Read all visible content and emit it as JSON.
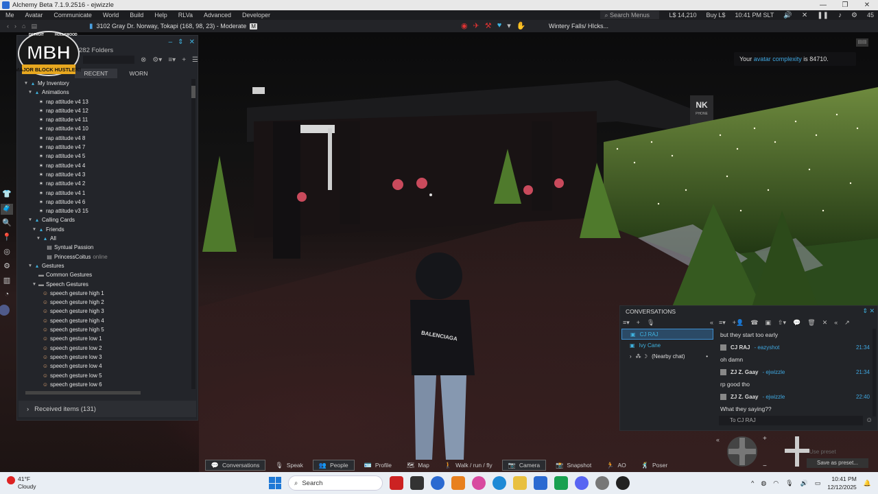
{
  "window": {
    "title": "Alchemy Beta 7.1.9.2516 - ejwizzle",
    "controls": [
      "—",
      "❐",
      "✕"
    ]
  },
  "menubar": {
    "items": [
      "Me",
      "Avatar",
      "Communicate",
      "World",
      "Build",
      "Help",
      "RLVa",
      "Advanced",
      "Developer"
    ],
    "search_placeholder": "Search Menus",
    "balance": "L$ 14,210",
    "buy": "Buy L$",
    "time": "10:41 PM SLT",
    "fps": "45"
  },
  "navbar": {
    "location": "3102 Gray Dr. Norway, Tokapi (168, 98, 23) - Moderate",
    "rating": "M",
    "parcel": "Wintery Falls/ HIcks..."
  },
  "inventory": {
    "folders_count": "282 Folders",
    "tabs": [
      "RECENT",
      "WORN"
    ],
    "received": "Received items (131)",
    "tree": [
      {
        "depth": 0,
        "arrow": "▼",
        "icon": "folder",
        "label": "My Inventory"
      },
      {
        "depth": 1,
        "arrow": "▼",
        "icon": "folder",
        "label": "Animations"
      },
      {
        "depth": 2,
        "arrow": "",
        "icon": "anim",
        "label": "rap attitude v4 13"
      },
      {
        "depth": 2,
        "arrow": "",
        "icon": "anim",
        "label": "rap attitude v4 12"
      },
      {
        "depth": 2,
        "arrow": "",
        "icon": "anim",
        "label": "rap attitude v4 11"
      },
      {
        "depth": 2,
        "arrow": "",
        "icon": "anim",
        "label": "rap attitude v4 10"
      },
      {
        "depth": 2,
        "arrow": "",
        "icon": "anim",
        "label": "rap attitude v4 8"
      },
      {
        "depth": 2,
        "arrow": "",
        "icon": "anim",
        "label": "rap attitude v4 7"
      },
      {
        "depth": 2,
        "arrow": "",
        "icon": "anim",
        "label": "rap attitude v4 5"
      },
      {
        "depth": 2,
        "arrow": "",
        "icon": "anim",
        "label": "rap attitude v4 4"
      },
      {
        "depth": 2,
        "arrow": "",
        "icon": "anim",
        "label": "rap attitude v4 3"
      },
      {
        "depth": 2,
        "arrow": "",
        "icon": "anim",
        "label": "rap attitude v4 2"
      },
      {
        "depth": 2,
        "arrow": "",
        "icon": "anim",
        "label": "rap attitude v4 1"
      },
      {
        "depth": 2,
        "arrow": "",
        "icon": "anim",
        "label": "rap attitude v4 6"
      },
      {
        "depth": 2,
        "arrow": "",
        "icon": "anim",
        "label": "rap attitude v3 15"
      },
      {
        "depth": 1,
        "arrow": "▼",
        "icon": "folder",
        "label": "Calling Cards"
      },
      {
        "depth": 2,
        "arrow": "▼",
        "icon": "folder",
        "label": "Friends"
      },
      {
        "depth": 3,
        "arrow": "▼",
        "icon": "folder",
        "label": "All"
      },
      {
        "depth": 4,
        "arrow": "",
        "icon": "card",
        "label": "Syntual Passion"
      },
      {
        "depth": 4,
        "arrow": "",
        "icon": "card",
        "label": "PrincessCoitus",
        "suffix": "online"
      },
      {
        "depth": 1,
        "arrow": "▼",
        "icon": "folder",
        "label": "Gestures"
      },
      {
        "depth": 2,
        "arrow": "",
        "icon": "gfolder",
        "label": "Common Gestures"
      },
      {
        "depth": 2,
        "arrow": "▼",
        "icon": "gfolder",
        "label": "Speech Gestures"
      },
      {
        "depth": 3,
        "arrow": "",
        "icon": "gesture",
        "label": "speech gesture high 1"
      },
      {
        "depth": 3,
        "arrow": "",
        "icon": "gesture",
        "label": "speech gesture high 2"
      },
      {
        "depth": 3,
        "arrow": "",
        "icon": "gesture",
        "label": "speech gesture high 3"
      },
      {
        "depth": 3,
        "arrow": "",
        "icon": "gesture",
        "label": "speech gesture high 4"
      },
      {
        "depth": 3,
        "arrow": "",
        "icon": "gesture",
        "label": "speech gesture high 5"
      },
      {
        "depth": 3,
        "arrow": "",
        "icon": "gesture",
        "label": "speech gesture low 1"
      },
      {
        "depth": 3,
        "arrow": "",
        "icon": "gesture",
        "label": "speech gesture low 2"
      },
      {
        "depth": 3,
        "arrow": "",
        "icon": "gesture",
        "label": "speech gesture low 3"
      },
      {
        "depth": 3,
        "arrow": "",
        "icon": "gesture",
        "label": "speech gesture low 4"
      },
      {
        "depth": 3,
        "arrow": "",
        "icon": "gesture",
        "label": "speech gesture low 5"
      },
      {
        "depth": 3,
        "arrow": "",
        "icon": "gesture",
        "label": "speech gesture low 6"
      }
    ]
  },
  "logo": {
    "name": "MBH",
    "subtitle": "MAJOR BLOCK HUSTLERS",
    "stars_left": "DETROIT",
    "stars_right": "HOLLYWOOD"
  },
  "scene": {
    "sign": "NK",
    "sign_sub": "PHONE",
    "jacket": "BALENCIAGA"
  },
  "notice": {
    "prefix": "Your",
    "link": "avatar complexity",
    "middle": "is",
    "value": "84710."
  },
  "conversations": {
    "title": "CONVERSATIONS",
    "list": [
      {
        "name": "CJ RAJ",
        "active": true
      },
      {
        "name": "Ivy Cane",
        "active": false
      },
      {
        "name": "(Nearby chat)",
        "active": false,
        "nearby": true
      }
    ],
    "messages": [
      {
        "type": "text",
        "text": "but they start too early"
      },
      {
        "type": "header",
        "who": "CJ RAJ",
        "handle": "- eazyshot",
        "time": "21:34"
      },
      {
        "type": "text",
        "text": "oh damn"
      },
      {
        "type": "header",
        "who": "ZJ Z. Gaay",
        "handle": "- ejwizzle",
        "time": "21:34"
      },
      {
        "type": "text",
        "text": "rp good tho"
      },
      {
        "type": "header",
        "who": "ZJ Z. Gaay",
        "handle": "- ejwizzle",
        "time": "22:40"
      },
      {
        "type": "text",
        "text": "What they saying??"
      }
    ],
    "input_placeholder": "To CJ RAJ"
  },
  "camera_presets": {
    "select": "Use preset",
    "save": "Save as preset..."
  },
  "bottombar": [
    {
      "label": "Conversations",
      "icon": "💬",
      "active": true
    },
    {
      "label": "Speak",
      "icon": "🎙",
      "active": false
    },
    {
      "label": "People",
      "icon": "👥",
      "active": true
    },
    {
      "label": "Profile",
      "icon": "🪪",
      "active": false
    },
    {
      "label": "Map",
      "icon": "🗺",
      "active": false
    },
    {
      "label": "Walk / run / fly",
      "icon": "🚶",
      "active": false
    },
    {
      "label": "Camera",
      "icon": "📷",
      "active": true
    },
    {
      "label": "Snapshot",
      "icon": "📸",
      "active": false
    },
    {
      "label": "AO",
      "icon": "🏃",
      "active": false
    },
    {
      "label": "Poser",
      "icon": "🕺",
      "active": false
    }
  ],
  "taskbar": {
    "temp": "41°F",
    "condition": "Cloudy",
    "search": "Search",
    "time": "10:41 PM",
    "date": "12/12/2025"
  },
  "colors": {
    "accent": "#3fb3e0",
    "link": "#3fa7e0",
    "panel": "#23252a"
  }
}
